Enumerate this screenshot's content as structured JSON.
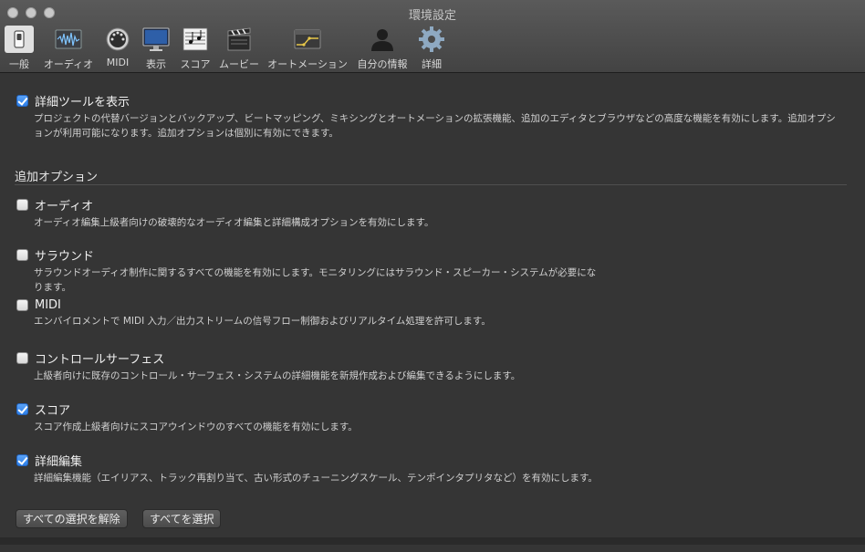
{
  "window": {
    "title": "環境設定"
  },
  "toolbar": {
    "tabs": [
      {
        "label": "一般",
        "icon": "switch-icon"
      },
      {
        "label": "オーディオ",
        "icon": "waveform-icon"
      },
      {
        "label": "MIDI",
        "icon": "midi-port-icon"
      },
      {
        "label": "表示",
        "icon": "monitor-icon"
      },
      {
        "label": "スコア",
        "icon": "score-icon"
      },
      {
        "label": "ムービー",
        "icon": "clapperboard-icon"
      },
      {
        "label": "オートメーション",
        "icon": "automation-icon"
      },
      {
        "label": "自分の情報",
        "icon": "person-icon"
      },
      {
        "label": "詳細",
        "icon": "gear-icon"
      }
    ],
    "selected_tab": "詳細"
  },
  "main": {
    "primary": {
      "title": "詳細ツールを表示",
      "checked": true,
      "desc": "プロジェクトの代替バージョンとバックアップ、ビートマッピング、ミキシングとオートメーションの拡張機能、追加のエディタとブラウザなどの高度な機能を有効にします。追加オプションが利用可能になります。追加オプションは個別に有効にできます。"
    },
    "section_heading": "追加オプション",
    "options": [
      {
        "title": "オーディオ",
        "checked": false,
        "desc": "オーディオ編集上級者向けの破壊的なオーディオ編集と詳細構成オプションを有効にします。"
      },
      {
        "title": "サラウンド",
        "checked": false,
        "desc": "サラウンドオーディオ制作に関するすべての機能を有効にします。モニタリングにはサラウンド・スピーカー・システムが必要になります。"
      },
      {
        "title": "MIDI",
        "checked": false,
        "desc": "エンバイロメントで MIDI 入力／出力ストリームの信号フロー制御およびリアルタイム処理を許可します。"
      },
      {
        "title": "コントロールサーフェス",
        "checked": false,
        "desc": "上級者向けに既存のコントロール・サーフェス・システムの詳細機能を新規作成および編集できるようにします。"
      },
      {
        "title": "スコア",
        "checked": true,
        "desc": "スコア作成上級者向けにスコアウインドウのすべての機能を有効にします。"
      },
      {
        "title": "詳細編集",
        "checked": true,
        "desc": "詳細編集機能（エイリアス、トラック再割り当て、古い形式のチューニングスケール、テンポインタプリタなど）を有効にします。"
      }
    ],
    "buttons": {
      "deselect_all": "すべての選択を解除",
      "select_all": "すべてを選択"
    }
  }
}
